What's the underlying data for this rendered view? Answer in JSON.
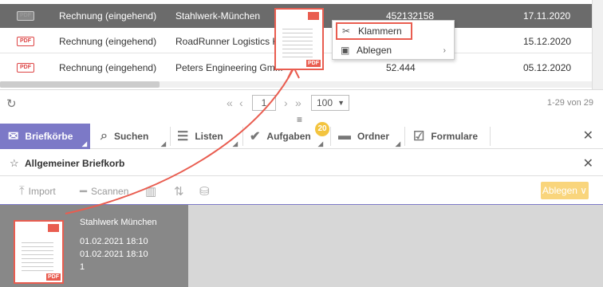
{
  "table": {
    "rows": [
      {
        "type": "Rechnung (eingehend)",
        "sender": "Stahlwerk-München",
        "number": "452132158",
        "date": "17.11.2020",
        "selected": true
      },
      {
        "type": "Rechnung (eingehend)",
        "sender": "RoadRunner Logistics Ko",
        "number": "",
        "date": "15.12.2020",
        "selected": false
      },
      {
        "type": "Rechnung (eingehend)",
        "sender": "Peters Engineering Gm...",
        "number": "52.444",
        "date": "05.12.2020",
        "selected": false
      }
    ],
    "pdf_label": "PDF"
  },
  "pager": {
    "page": "1",
    "page_size": "100",
    "info": "1-29 von 29"
  },
  "tabs": {
    "briefkoerbe": "Briefkörbe",
    "suchen": "Suchen",
    "listen": "Listen",
    "aufgaben": "Aufgaben",
    "aufgaben_badge": "20",
    "ordner": "Ordner",
    "formulare": "Formulare"
  },
  "panel": {
    "title": "Allgemeiner Briefkorb"
  },
  "toolbar": {
    "import": "Import",
    "scannen": "Scannen",
    "ablegen": "Ablegen"
  },
  "card": {
    "sender": "Stahlwerk München",
    "date1": "01.02.2021 18:10",
    "date2": "01.02.2021 18:10",
    "count": "1"
  },
  "context_menu": {
    "klammern": "Klammern",
    "ablegen": "Ablegen"
  },
  "colors": {
    "accent": "#7c79c7",
    "highlight": "#e95d50",
    "badge": "#f3c43f",
    "ablegen_button": "#f9d57c"
  }
}
